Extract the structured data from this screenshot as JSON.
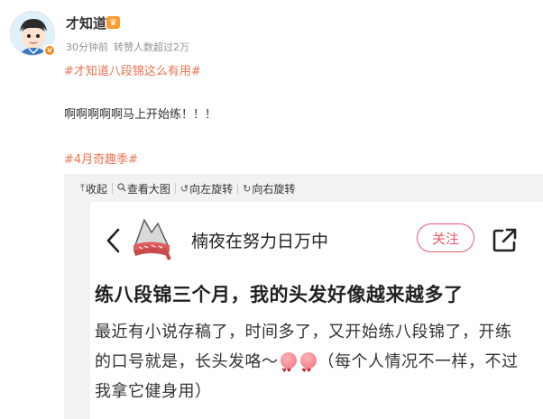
{
  "user": {
    "name": "才知道",
    "time": "30分钟前",
    "reposts": "转赞人数超过2万"
  },
  "post": {
    "hashtag1": "#才知道八段锦这么有用#",
    "text": "啊啊啊啊啊马上开始练！！！",
    "hashtag2": "#4月奇趣季#"
  },
  "image_toolbar": {
    "collapse": "收起",
    "view_large": "查看大图",
    "rotate_left": "向左旋转",
    "rotate_right": "向右旋转"
  },
  "screenshot": {
    "author": "楠夜在努力日万中",
    "follow": "关注",
    "title": "练八段锦三个月，我的头发好像越来越多了",
    "body_part1": "最近有小说存稿了，时间多了，又开始练八段锦了，开练的口号就是，长头发咯～",
    "body_part2": "（每个人情况不一样，不过我拿它健身用）"
  },
  "colors": {
    "hashtag": "#eb7350",
    "follow": "#e75b6b",
    "vip_badge": "#ff9a2e"
  },
  "icons": [
    "avatar",
    "vip-icon",
    "collapse-icon",
    "magnifier-icon",
    "rotate-left-icon",
    "rotate-right-icon",
    "back-arrow-icon",
    "share-icon",
    "heart-eyes-emoji"
  ]
}
